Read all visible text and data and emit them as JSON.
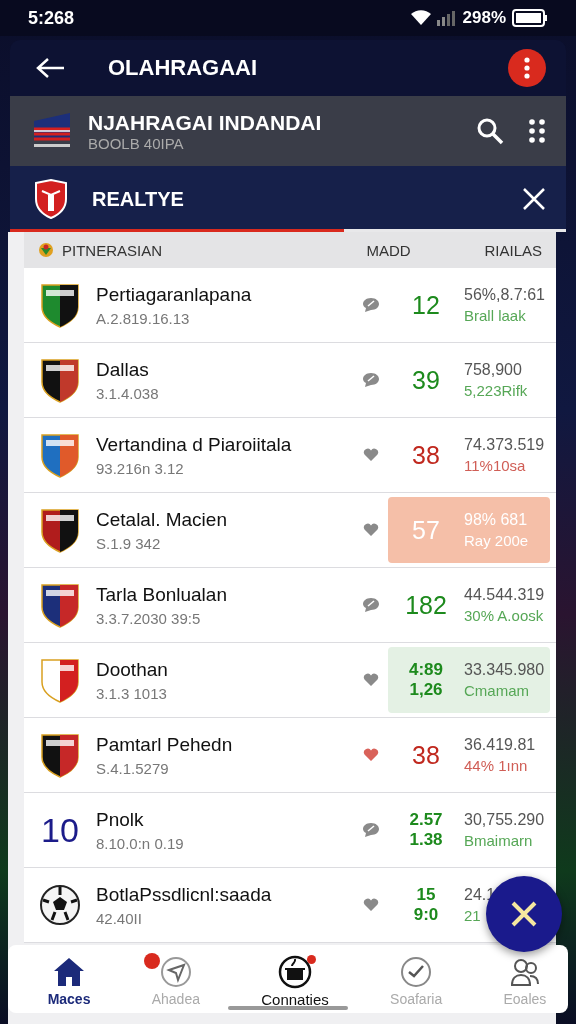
{
  "status_bar": {
    "time": "5:268",
    "battery": "298%"
  },
  "app_bar": {
    "title": "OLAHRAGAAI"
  },
  "league_header": {
    "title": "NJAHRAGAI INDANDAI",
    "subtitle": "BOOLB 40IPA"
  },
  "team_tab": {
    "label": "REALTYE",
    "level": 0.6
  },
  "table": {
    "columns": [
      "PITNERASIAN",
      "MADD",
      "RIAILAS"
    ],
    "rows": [
      {
        "kind": "shield",
        "name": "Pertiagaranlapana",
        "detail": "A.2.819.16.13",
        "heart": false,
        "liked": false,
        "scores": [
          "12"
        ],
        "color": "#1d8a1d",
        "value": "56%,8.7:61",
        "note": "Brall laak"
      },
      {
        "kind": "shield",
        "name": "Dallas",
        "detail": "3.1.4.038",
        "heart": false,
        "liked": false,
        "scores": [
          "39"
        ],
        "color": "#1d8a1d",
        "value": "758,900",
        "note": "5,223Rifk"
      },
      {
        "kind": "shield",
        "name": "Vertandina d Piaroiitala",
        "detail": "93.216n 3.12",
        "heart": true,
        "liked": false,
        "scores": [
          "38"
        ],
        "color": "#c0281e",
        "value": "74.373.519",
        "note": "11%10sa"
      },
      {
        "kind": "shield",
        "name": "Cetalal. Macien",
        "detail": "S.1.9 342",
        "heart": true,
        "liked": false,
        "scores": [
          "57"
        ],
        "color": "#f5bfa8",
        "highlighted": true,
        "strong": true,
        "value": "98% 681",
        "note": "Ray 200e"
      },
      {
        "kind": "shield",
        "name": "Tarla Bonlualan",
        "detail": "3.3.7.2030 39:5",
        "heart": false,
        "liked": false,
        "scores": [
          "182"
        ],
        "color": "#1d8a1d",
        "value": "44.544.319",
        "note": "30% A.oosk"
      },
      {
        "kind": "shield",
        "name": "Doothan",
        "detail": "3.1.3 1013",
        "heart": true,
        "liked": false,
        "scores": [
          "4:89",
          "1,26"
        ],
        "color": "#1d8a1d",
        "highlighted": true,
        "strong": false,
        "value": "33.345.980",
        "note": "Cmamam"
      },
      {
        "kind": "shield",
        "name": "Pamtarl Pehedn",
        "detail": "S.4.1.5279",
        "heart": true,
        "liked": true,
        "scores": [
          "38"
        ],
        "color": "#c0281e",
        "value": "36.419.81",
        "note": "44% 1ınn"
      },
      {
        "kind": "number",
        "emblem_text": "10",
        "name": "Pnolk",
        "detail": "8.10.0:n 0.19",
        "heart": false,
        "liked": false,
        "scores": [
          "2.57",
          "1.38"
        ],
        "color": "#1d8a1d",
        "value": "30,755.290",
        "note": "Bmaimarn"
      },
      {
        "kind": "ball",
        "name": "BotlaPssdlicnl:saada",
        "detail": "42.40II",
        "heart": true,
        "liked": false,
        "scores": [
          "15",
          "9:0"
        ],
        "color": "#1d8a1d",
        "value": "24.1",
        "note": "21"
      }
    ]
  },
  "nav": [
    {
      "label": "Maces",
      "selected": true,
      "badge": false,
      "bold": false
    },
    {
      "label": "Ahadea",
      "selected": false,
      "badge": true,
      "bold": false
    },
    {
      "label": "Connaties",
      "selected": false,
      "badge": true,
      "bold": true
    },
    {
      "label": "Soafaria",
      "selected": false,
      "badge": false,
      "bold": false
    },
    {
      "label": "Eoales",
      "selected": false,
      "badge": false,
      "bold": false
    }
  ]
}
